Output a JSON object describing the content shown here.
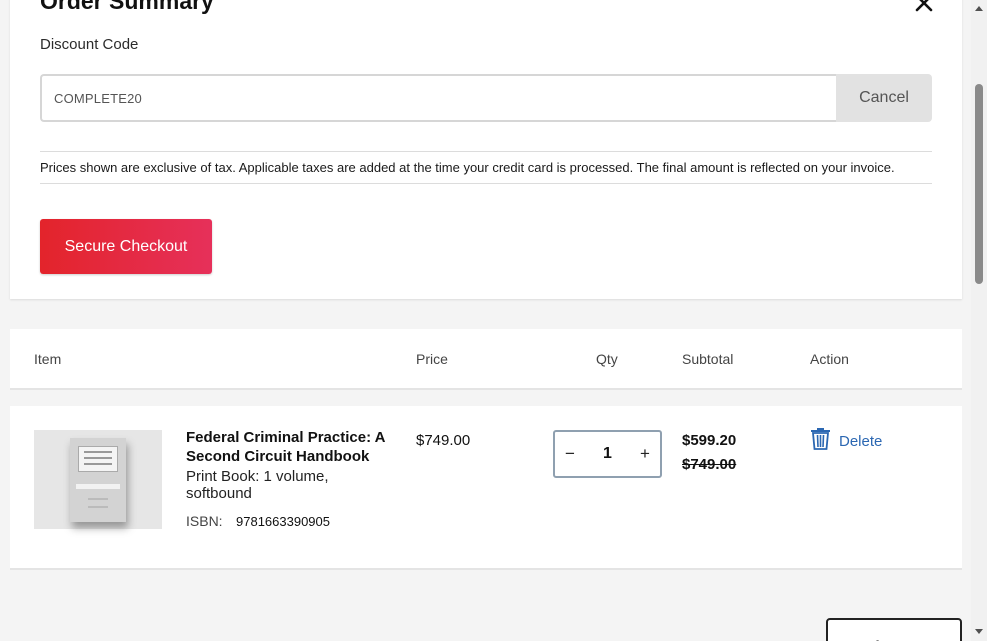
{
  "summary": {
    "title": "Order Summary",
    "discount_label": "Discount Code",
    "discount_value": "COMPLETE20",
    "cancel_label": "Cancel",
    "tax_note": "Prices shown are exclusive of tax. Applicable taxes are added at the time your credit card is processed. The final amount is reflected on your invoice.",
    "checkout_label": "Secure Checkout"
  },
  "cart": {
    "headers": {
      "item": "Item",
      "price": "Price",
      "qty": "Qty",
      "subtotal": "Subtotal",
      "action": "Action"
    },
    "items": [
      {
        "title": "Federal Criminal Practice: A Second Circuit Handbook",
        "format": "Print Book: 1 volume, softbound",
        "isbn_label": "ISBN:",
        "isbn": "9781663390905",
        "price": "$749.00",
        "qty": "1",
        "qty_minus": "−",
        "qty_plus": "+",
        "subtotal": "$599.20",
        "subtotal_original": "$749.00",
        "delete_label": "Delete"
      }
    ],
    "update_label": "Update Cart"
  },
  "colors": {
    "checkout_start": "#e3242b",
    "checkout_end": "#e6305a",
    "link_blue": "#2b67b2"
  },
  "icons": {
    "close": "close-icon",
    "delete": "trash-icon"
  }
}
